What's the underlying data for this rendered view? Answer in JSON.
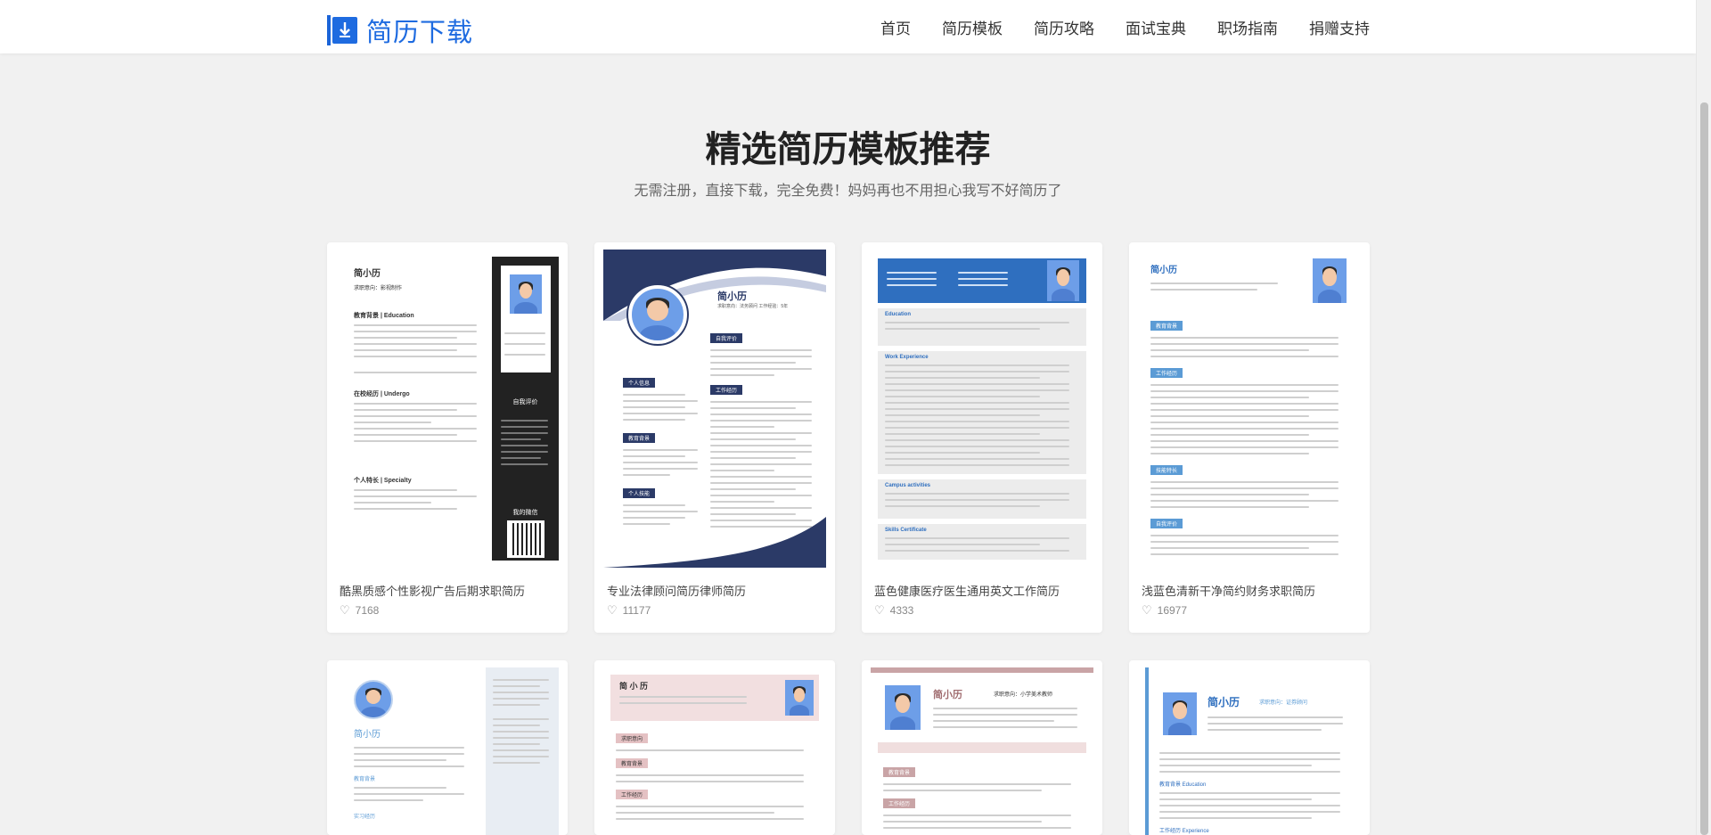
{
  "header": {
    "logo_text": "简历下载",
    "nav": [
      "首页",
      "简历模板",
      "简历攻略",
      "面试宝典",
      "职场指南",
      "捐赠支持"
    ]
  },
  "hero": {
    "title": "精选简历模板推荐",
    "subtitle": "无需注册，直接下载，完全免费！妈妈再也不用担心我写不好简历了"
  },
  "cards": [
    {
      "title": "酷黑质感个性影视广告后期求职简历",
      "likes": "7168"
    },
    {
      "title": "专业法律顾问简历律师简历",
      "likes": "11177"
    },
    {
      "title": "蓝色健康医疗医生通用英文工作简历",
      "likes": "4333"
    },
    {
      "title": "浅蓝色清新干净简约财务求职简历",
      "likes": "16977"
    }
  ],
  "thumbs": {
    "t1": {
      "name": "简小历",
      "intent": "求职意向：影视制作",
      "s1": "教育背景 | Education",
      "s2": "在校经历 | Undergo",
      "s3": "个人特长 | Specialty",
      "side1": "自我评价",
      "side2": "我的微信"
    },
    "t2": {
      "name": "简小历",
      "intent": "求职意向：法务顾问  工作经验：5年",
      "s1": "个人信息",
      "s2": "教育背景",
      "s3": "个人技能",
      "s4": "自我评价",
      "s5": "工作经历"
    },
    "t3": {
      "s1": "Education",
      "s2": "Work Experience",
      "s3": "Campus activities",
      "s4": "Skills Certificate"
    },
    "t4": {
      "name": "简小历",
      "s1": "教育背景",
      "s2": "工作经历",
      "s3": "技能特长",
      "s4": "自我评价"
    },
    "t5": {
      "name": "简小历",
      "s1": "教育背景",
      "s2": "实习经历"
    },
    "t6": {
      "name": "简 小 历",
      "s1": "求职意向",
      "s2": "教育背景",
      "s3": "工作经历"
    },
    "t7": {
      "name": "简小历",
      "intent": "求职意向：小学美术教师",
      "s1": "教育背景",
      "s2": "工作经历"
    },
    "t8": {
      "name": "简小历",
      "intent": "求职意向：证券顾问",
      "s1": "教育背景 Education",
      "s2": "工作经历 Experience"
    }
  }
}
